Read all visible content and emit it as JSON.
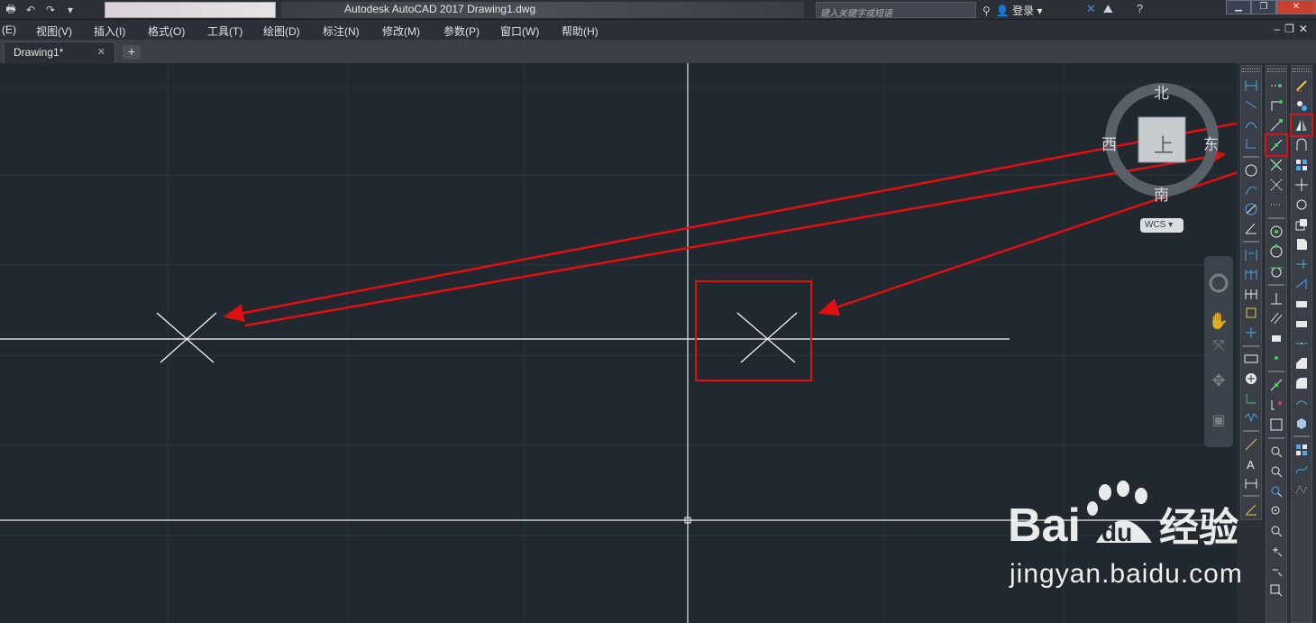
{
  "title_bar": {
    "app_title": "Autodesk AutoCAD 2017    Drawing1.dwg",
    "search_placeholder": "键入关键字或短语",
    "login_label": "登录",
    "quick_access_icons": [
      "print-icon",
      "undo-icon",
      "redo-icon",
      "qat-dropdown-icon"
    ],
    "window_controls": [
      "minimize-icon",
      "restore-icon",
      "close-icon"
    ]
  },
  "menu": {
    "edit_partial": "(E)",
    "items": [
      "视图(V)",
      "插入(I)",
      "格式(O)",
      "工具(T)",
      "绘图(D)",
      "标注(N)",
      "修改(M)",
      "参数(P)",
      "窗口(W)",
      "帮助(H)"
    ]
  },
  "tabs": [
    {
      "label": "Drawing1*"
    }
  ],
  "viewcube": {
    "north": "北",
    "south": "南",
    "east": "东",
    "west": "西",
    "face_label": "上",
    "wcs_label": "WCS"
  },
  "watermark": {
    "brand": "Bai",
    "brand_suffix": "du",
    "product": "经验",
    "url": "jingyan.baidu.com"
  },
  "colors": {
    "canvas_bg": "#212830",
    "annotation_red": "#e01010",
    "line_white": "#ffffff"
  }
}
